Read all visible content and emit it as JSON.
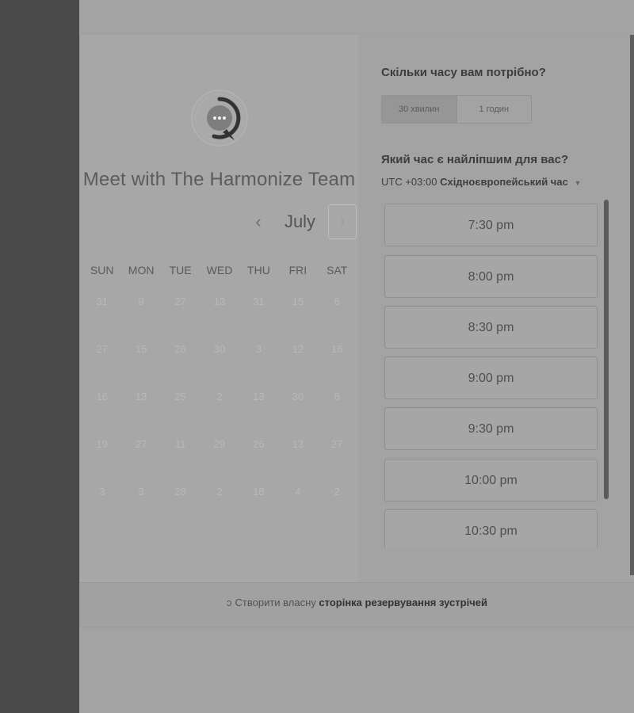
{
  "host": {
    "title": "Meet with The Harmonize Team"
  },
  "calendar": {
    "month": "July",
    "prev_glyph": "‹",
    "next_glyph": "›",
    "weekdays": [
      "SUN",
      "MON",
      "TUE",
      "WED",
      "THU",
      "FRI",
      "SAT"
    ],
    "weeks": [
      [
        "31",
        "9",
        "27",
        "13",
        "31",
        "15",
        "6"
      ],
      [
        "27",
        "15",
        "26",
        "30",
        "3",
        "12",
        "16"
      ],
      [
        "16",
        "13",
        "25",
        "2",
        "13",
        "30",
        "8"
      ],
      [
        "19",
        "27",
        "11",
        "29",
        "26",
        "13",
        "27"
      ],
      [
        "3",
        "3",
        "28",
        "2",
        "18",
        "4",
        "2"
      ]
    ]
  },
  "booking": {
    "duration_question": "Скільки часу вам потрібно?",
    "durations": [
      {
        "label": "30 хвилин",
        "selected": true
      },
      {
        "label": "1 годин",
        "selected": false
      }
    ],
    "time_question": "Який час є найліпшим для вас?",
    "timezone_offset": "UTC +03:00",
    "timezone_name": "Східноєвропейський час",
    "slots": [
      "7:30 pm",
      "8:00 pm",
      "8:30 pm",
      "9:00 pm",
      "9:30 pm",
      "10:00 pm",
      "10:30 pm"
    ]
  },
  "footer": {
    "prefix": "Створити власну",
    "link": "сторінка резервування зустрічей"
  },
  "colors": {
    "sidebar": "#4a4a4a",
    "overlay_background": "#a3a3a3"
  }
}
